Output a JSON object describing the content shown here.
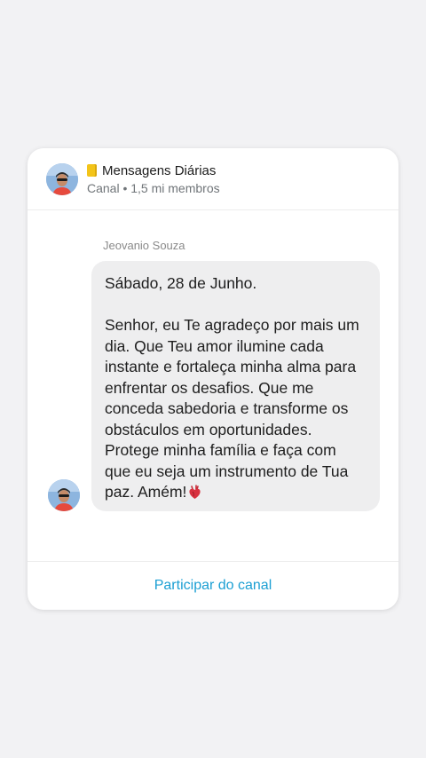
{
  "channel": {
    "emoji_icon": "ledger-icon",
    "name": "Mensagens Diárias",
    "subtitle": "Canal • 1,5 mi membros"
  },
  "message": {
    "sender": "Jeovanio Souza",
    "date_line": "Sábado, 28 de Junho.",
    "body": "Senhor, eu Te agradeço por mais um dia. Que Teu amor ilumine cada instante e fortaleça minha alma para enfrentar os desafios. Que me conceda sabedoria e transforme os obstáculos em oportunidades. Protege minha família e faça com que eu seja um instrumento de Tua paz. Amém!",
    "trailing_icon": "anatomical-heart-icon"
  },
  "footer": {
    "join_label": "Participar do canal"
  },
  "colors": {
    "accent": "#1b9fd3",
    "bubble": "#eeeeef",
    "background": "#f2f2f4"
  }
}
